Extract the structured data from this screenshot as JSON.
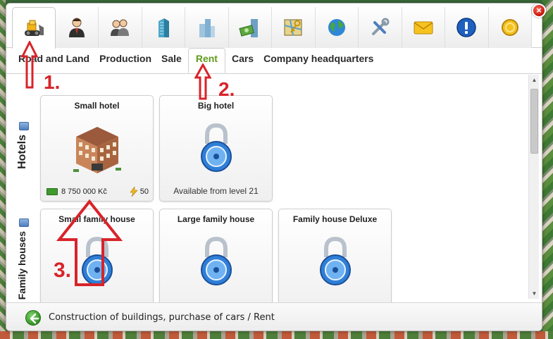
{
  "close_label": "×",
  "toolbar": {
    "tabs": [
      {
        "icon": "bulldozer-icon",
        "active": true
      },
      {
        "icon": "businessman-icon"
      },
      {
        "icon": "people-icon"
      },
      {
        "icon": "skyscraper-icon"
      },
      {
        "icon": "buildings-icon"
      },
      {
        "icon": "money-building-icon"
      },
      {
        "icon": "map-key-icon"
      },
      {
        "icon": "globe-icon"
      },
      {
        "icon": "tools-icon"
      },
      {
        "icon": "envelope-icon"
      },
      {
        "icon": "info-icon"
      },
      {
        "icon": "coin-icon"
      }
    ]
  },
  "subtabs": [
    {
      "label": "Road and Land"
    },
    {
      "label": "Production"
    },
    {
      "label": "Sale"
    },
    {
      "label": "Rent",
      "active": true
    },
    {
      "label": "Cars"
    },
    {
      "label": "Company headquarters"
    }
  ],
  "sections": {
    "hotels": {
      "label": "Hotels",
      "cards": [
        {
          "title": "Small hotel",
          "price": "8 750 000 Kč",
          "energy": "50",
          "image": "hotel-building-icon"
        },
        {
          "title": "Big hotel",
          "note": "Available from level 21",
          "image": "padlock-icon"
        }
      ]
    },
    "family_houses": {
      "label": "Family houses",
      "cards": [
        {
          "title": "Small family house",
          "image": "padlock-icon"
        },
        {
          "title": "Large family house",
          "image": "padlock-icon"
        },
        {
          "title": "Family house Deluxe",
          "image": "padlock-icon"
        }
      ]
    }
  },
  "footer": {
    "breadcrumb": "Construction of buildings, purchase of cars / Rent"
  },
  "annotations": {
    "step1": "1.",
    "step2": "2.",
    "step3": "3.",
    "color": "#d8232a"
  },
  "colors": {
    "active_tab_text": "#5f9a1c",
    "padlock_blue": "#2f7fd8"
  }
}
